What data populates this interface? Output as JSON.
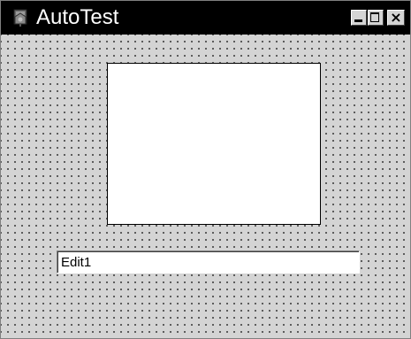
{
  "window": {
    "title": "AutoTest",
    "app_icon": "delphi-app-icon",
    "titlebar_color": "#000000",
    "title_text_color": "#ffffff"
  },
  "caption_buttons": {
    "minimize_icon": "minimize-icon",
    "maximize_icon": "maximize-icon",
    "close_glyph": "×"
  },
  "form": {
    "background_color": "#d4d4d4",
    "image_box_color": "#ffffff",
    "edit1": {
      "value": "Edit1"
    }
  }
}
